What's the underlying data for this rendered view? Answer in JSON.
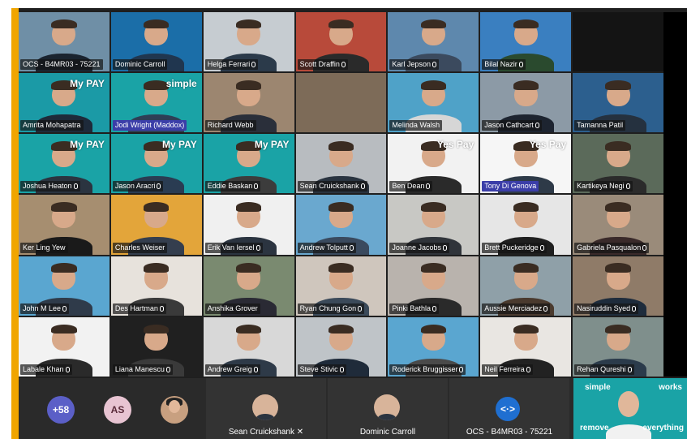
{
  "participants": [
    {
      "name": "OCS - B4MR03 - 75221",
      "mic": false,
      "bg": "#6f8fa6",
      "shirt": "#1a2430",
      "overlay": ""
    },
    {
      "name": "Dominic Carroll",
      "mic": false,
      "bg": "#1b6ea8",
      "shirt": "#20364f",
      "overlay": ""
    },
    {
      "name": "Helga Ferrari",
      "mic": true,
      "bg": "#c6ccd1",
      "shirt": "#2b3a4a",
      "overlay": ""
    },
    {
      "name": "Scott Draffin",
      "mic": true,
      "bg": "#b84a3a",
      "shirt": "#2a2a2a",
      "overlay": ""
    },
    {
      "name": "Karl Jepson",
      "mic": true,
      "bg": "#5e88ad",
      "shirt": "#3b4a5e",
      "overlay": ""
    },
    {
      "name": "Bilal Nazir",
      "mic": true,
      "bg": "#3a7fc0",
      "shirt": "#2a4a2e",
      "overlay": ""
    },
    {
      "name": "",
      "mic": false,
      "bg": "#141414",
      "shirt": "#141414",
      "overlay": ""
    },
    {
      "name": "Amrita Mohapatra",
      "mic": false,
      "bg": "#1b9aa6",
      "shirt": "#1e2a3a",
      "overlay": "My PAY"
    },
    {
      "name": "Jodi Wright (Maddox)",
      "mic": false,
      "bg": "#1aa3a6",
      "shirt": "#2e3e56",
      "overlay": "simple",
      "highlight": true
    },
    {
      "name": "Richard Webb",
      "mic": false,
      "bg": "#9c8670",
      "shirt": "#2a2f3a",
      "overlay": ""
    },
    {
      "name": "",
      "mic": false,
      "bg": "#7d6b58",
      "shirt": "#1d1d2a",
      "overlay": ""
    },
    {
      "name": "Melinda Walsh",
      "mic": false,
      "bg": "#4fa2c8",
      "shirt": "#d6d6d6",
      "overlay": ""
    },
    {
      "name": "Jason Cathcart",
      "mic": true,
      "bg": "#8c9aa6",
      "shirt": "#1d2430",
      "overlay": ""
    },
    {
      "name": "Tamanna Patil",
      "mic": false,
      "bg": "#2c5f8e",
      "shirt": "#25313f",
      "overlay": ""
    },
    {
      "name": "Joshua Heaton",
      "mic": true,
      "bg": "#1aa3a6",
      "shirt": "#2b3440",
      "overlay": "My PAY"
    },
    {
      "name": "Jason Aracri",
      "mic": true,
      "bg": "#1aa3a6",
      "shirt": "#2a3c52",
      "overlay": "My PAY"
    },
    {
      "name": "Eddie Baskan",
      "mic": true,
      "bg": "#1aa3a6",
      "shirt": "#3c3c3c",
      "overlay": "My PAY"
    },
    {
      "name": "Sean Cruickshank",
      "mic": true,
      "bg": "#b8bcc0",
      "shirt": "#2a3440",
      "overlay": ""
    },
    {
      "name": "Ben Dean",
      "mic": true,
      "bg": "#f2f2f2",
      "shirt": "#2a2a2a",
      "overlay": "Yes Pay"
    },
    {
      "name": "Tony Di Genova",
      "mic": false,
      "bg": "#f6f6f6",
      "shirt": "#2e3a48",
      "overlay": "Yes Pay",
      "highlight": true
    },
    {
      "name": "Kartikeya Negi",
      "mic": true,
      "bg": "#5b6a5a",
      "shirt": "#2b2b2b",
      "overlay": ""
    },
    {
      "name": "Ker Ling Yew",
      "mic": false,
      "bg": "#a68e70",
      "shirt": "#1a1a1a",
      "overlay": ""
    },
    {
      "name": "Charles Weiser",
      "mic": false,
      "bg": "#e3a53a",
      "shirt": "#343e4e",
      "overlay": ""
    },
    {
      "name": "Erik Van Iersel",
      "mic": true,
      "bg": "#f0f0f0",
      "shirt": "#2b3440",
      "overlay": ""
    },
    {
      "name": "Andrew Tolputt",
      "mic": true,
      "bg": "#6aa8cf",
      "shirt": "#3a4a5e",
      "overlay": ""
    },
    {
      "name": "Joanne Jacobs",
      "mic": true,
      "bg": "#c8c8c4",
      "shirt": "#30343a",
      "overlay": ""
    },
    {
      "name": "Brett Puckeridge",
      "mic": true,
      "bg": "#e6e6e6",
      "shirt": "#1f1f1f",
      "overlay": ""
    },
    {
      "name": "Gabriela Pasqualon",
      "mic": true,
      "bg": "#9a8b7a",
      "shirt": "#3a2a2a",
      "overlay": ""
    },
    {
      "name": "John M Lee",
      "mic": true,
      "bg": "#5aa6d0",
      "shirt": "#2f3b4a",
      "overlay": ""
    },
    {
      "name": "Des Hartman",
      "mic": true,
      "bg": "#e7e2dc",
      "shirt": "#3a3a3a",
      "overlay": ""
    },
    {
      "name": "Anshika Grover",
      "mic": false,
      "bg": "#7a8a70",
      "shirt": "#2a2a34",
      "overlay": ""
    },
    {
      "name": "Ryan Chung Gon",
      "mic": true,
      "bg": "#cfc6bd",
      "shirt": "#3b4a5a",
      "overlay": ""
    },
    {
      "name": "Pinki Bathla",
      "mic": true,
      "bg": "#b9b3ad",
      "shirt": "#2a2a2a",
      "overlay": ""
    },
    {
      "name": "Aussie Merciadez",
      "mic": true,
      "bg": "#8fa0a8",
      "shirt": "#4a3a2e",
      "overlay": ""
    },
    {
      "name": "Nasiruddin Syed",
      "mic": true,
      "bg": "#8f7b68",
      "shirt": "#1e2c3c",
      "overlay": ""
    },
    {
      "name": "Labale Khan",
      "mic": true,
      "bg": "#f2f2f2",
      "shirt": "#2a2a2a",
      "overlay": ""
    },
    {
      "name": "Liana Manescu",
      "mic": true,
      "bg": "#202020",
      "shirt": "#3a3a3a",
      "overlay": ""
    },
    {
      "name": "Andrew Greig",
      "mic": true,
      "bg": "#d8d8d8",
      "shirt": "#2e3a48",
      "overlay": ""
    },
    {
      "name": "Steve Stivic",
      "mic": true,
      "bg": "#bfc4c8",
      "shirt": "#1f2b3a",
      "overlay": ""
    },
    {
      "name": "Roderick Bruggisser",
      "mic": true,
      "bg": "#5aa6d0",
      "shirt": "#4a4a4a",
      "overlay": ""
    },
    {
      "name": "Neil Ferreira",
      "mic": true,
      "bg": "#e9e6e2",
      "shirt": "#222",
      "overlay": ""
    },
    {
      "name": "Rehan Qureshi",
      "mic": true,
      "bg": "#7f8f8c",
      "shirt": "#2b3b4b",
      "overlay": ""
    }
  ],
  "bottom": {
    "overflow_count": "+58",
    "initials": "AS",
    "slots": [
      {
        "name": "Sean Cruickshank",
        "muted": true
      },
      {
        "name": "Dominic Carroll",
        "muted": false
      },
      {
        "name": "OCS - B4MR03 - 75221",
        "muted": false
      }
    ],
    "selfview_texts": [
      "simple",
      "works",
      "remove",
      "everything"
    ]
  },
  "colors": {
    "accent": "#f0a500",
    "brand_teal": "#1aa3a6",
    "highlight": "#3b3ea8"
  }
}
